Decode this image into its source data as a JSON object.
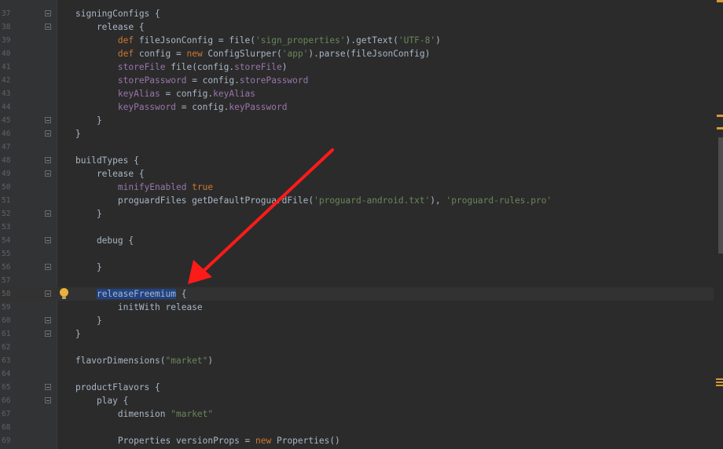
{
  "editor": {
    "lines": [
      {
        "num": "37",
        "segments": [
          {
            "text": "signingConfigs {",
            "cls": ""
          }
        ]
      },
      {
        "num": "38",
        "segments": [
          {
            "text": "    release {",
            "cls": ""
          }
        ]
      },
      {
        "num": "39",
        "segments": [
          {
            "text": "        ",
            "cls": ""
          },
          {
            "text": "def",
            "cls": "kw"
          },
          {
            "text": " fileJsonConfig = file(",
            "cls": ""
          },
          {
            "text": "'sign_properties'",
            "cls": "str"
          },
          {
            "text": ").getText(",
            "cls": ""
          },
          {
            "text": "'UTF-8'",
            "cls": "str"
          },
          {
            "text": ")",
            "cls": ""
          }
        ]
      },
      {
        "num": "40",
        "segments": [
          {
            "text": "        ",
            "cls": ""
          },
          {
            "text": "def",
            "cls": "kw"
          },
          {
            "text": " config = ",
            "cls": ""
          },
          {
            "text": "new",
            "cls": "kw"
          },
          {
            "text": " ConfigSlurper(",
            "cls": ""
          },
          {
            "text": "'app'",
            "cls": "str"
          },
          {
            "text": ").parse(fileJsonConfig)",
            "cls": ""
          }
        ]
      },
      {
        "num": "41",
        "segments": [
          {
            "text": "        ",
            "cls": ""
          },
          {
            "text": "storeFile",
            "cls": "fld"
          },
          {
            "text": " file(config.",
            "cls": ""
          },
          {
            "text": "storeFile",
            "cls": "fld"
          },
          {
            "text": ")",
            "cls": ""
          }
        ]
      },
      {
        "num": "42",
        "segments": [
          {
            "text": "        ",
            "cls": ""
          },
          {
            "text": "storePassword",
            "cls": "fld"
          },
          {
            "text": " = config.",
            "cls": ""
          },
          {
            "text": "storePassword",
            "cls": "fld"
          }
        ]
      },
      {
        "num": "43",
        "segments": [
          {
            "text": "        ",
            "cls": ""
          },
          {
            "text": "keyAlias",
            "cls": "fld"
          },
          {
            "text": " = config.",
            "cls": ""
          },
          {
            "text": "keyAlias",
            "cls": "fld"
          }
        ]
      },
      {
        "num": "44",
        "segments": [
          {
            "text": "        ",
            "cls": ""
          },
          {
            "text": "keyPassword",
            "cls": "fld"
          },
          {
            "text": " = config.",
            "cls": ""
          },
          {
            "text": "keyPassword",
            "cls": "fld"
          }
        ]
      },
      {
        "num": "45",
        "segments": [
          {
            "text": "    }",
            "cls": ""
          }
        ]
      },
      {
        "num": "46",
        "segments": [
          {
            "text": "}",
            "cls": ""
          }
        ]
      },
      {
        "num": "47",
        "segments": []
      },
      {
        "num": "48",
        "segments": [
          {
            "text": "buildTypes {",
            "cls": ""
          }
        ]
      },
      {
        "num": "49",
        "segments": [
          {
            "text": "    release {",
            "cls": ""
          }
        ]
      },
      {
        "num": "50",
        "segments": [
          {
            "text": "        ",
            "cls": ""
          },
          {
            "text": "minifyEnabled",
            "cls": "fld"
          },
          {
            "text": " ",
            "cls": ""
          },
          {
            "text": "true",
            "cls": "kw"
          }
        ]
      },
      {
        "num": "51",
        "segments": [
          {
            "text": "        proguardFiles getDefaultProguardFile(",
            "cls": ""
          },
          {
            "text": "'proguard-android.txt'",
            "cls": "str"
          },
          {
            "text": "), ",
            "cls": ""
          },
          {
            "text": "'proguard-rules.pro'",
            "cls": "str"
          }
        ]
      },
      {
        "num": "52",
        "segments": [
          {
            "text": "    }",
            "cls": ""
          }
        ]
      },
      {
        "num": "53",
        "segments": []
      },
      {
        "num": "54",
        "segments": [
          {
            "text": "    debug {",
            "cls": ""
          }
        ]
      },
      {
        "num": "55",
        "segments": []
      },
      {
        "num": "56",
        "segments": [
          {
            "text": "    }",
            "cls": ""
          }
        ]
      },
      {
        "num": "57",
        "segments": []
      },
      {
        "num": "58",
        "segments": [
          {
            "text": "    ",
            "cls": ""
          },
          {
            "text": "releaseFreemium",
            "cls": "sel"
          },
          {
            "text": " {",
            "cls": ""
          }
        ]
      },
      {
        "num": "59",
        "segments": [
          {
            "text": "        initWith release",
            "cls": ""
          }
        ]
      },
      {
        "num": "60",
        "segments": [
          {
            "text": "    }",
            "cls": ""
          }
        ]
      },
      {
        "num": "61",
        "segments": [
          {
            "text": "}",
            "cls": ""
          }
        ]
      },
      {
        "num": "62",
        "segments": []
      },
      {
        "num": "63",
        "segments": [
          {
            "text": "flavorDimensions(",
            "cls": ""
          },
          {
            "text": "\"market\"",
            "cls": "str"
          },
          {
            "text": ")",
            "cls": ""
          }
        ]
      },
      {
        "num": "64",
        "segments": []
      },
      {
        "num": "65",
        "segments": [
          {
            "text": "productFlavors {",
            "cls": ""
          }
        ]
      },
      {
        "num": "66",
        "segments": [
          {
            "text": "    play {",
            "cls": ""
          }
        ]
      },
      {
        "num": "67",
        "segments": [
          {
            "text": "        dimension ",
            "cls": ""
          },
          {
            "text": "\"market\"",
            "cls": "str"
          }
        ]
      },
      {
        "num": "68",
        "segments": []
      },
      {
        "num": "69",
        "segments": [
          {
            "text": "        Properties versionProps = ",
            "cls": ""
          },
          {
            "text": "new",
            "cls": "kw"
          },
          {
            "text": " Properties()",
            "cls": ""
          }
        ]
      }
    ],
    "caret_line": "58",
    "intention_icon": "lightbulb-icon",
    "fold_lines": [
      "37",
      "38",
      "45",
      "46",
      "48",
      "49",
      "52",
      "54",
      "56",
      "58",
      "60",
      "61",
      "65",
      "66"
    ]
  },
  "annotation": {
    "icon": "red-arrow-icon",
    "color": "#ff0000"
  },
  "colors": {
    "background": "#2b2b2b",
    "keyword": "#cc7832",
    "string": "#6a8759",
    "field": "#9876aa",
    "selection": "#214283"
  }
}
